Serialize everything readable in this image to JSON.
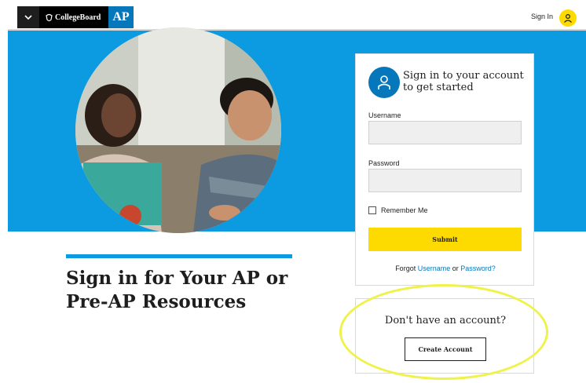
{
  "header": {
    "brand_text": "CollegeBoard",
    "ap_label": "AP",
    "signin_label": "Sign In",
    "icons": [
      "chevron-down-icon",
      "acorn-icon",
      "user-icon"
    ]
  },
  "hero": {
    "color": "#0c9ae0",
    "photo": "students-photo"
  },
  "main": {
    "title": "Sign in for Your AP or Pre-AP Resources"
  },
  "signin_card": {
    "heading": "Sign in to your account to get started",
    "username_label": "Username",
    "username_value": "",
    "password_label": "Password",
    "password_value": "",
    "remember_label": "Remember Me",
    "remember_checked": false,
    "submit_label": "Submit",
    "forgot_prefix": "Forgot",
    "forgot_username": "Username",
    "forgot_or": "or",
    "forgot_password": "Password?"
  },
  "create_card": {
    "heading": "Don't have an account?",
    "button_label": "Create Account"
  },
  "colors": {
    "brand_blue": "#0677ba",
    "hero_blue": "#0c9ae0",
    "submit_yellow": "#fedb00",
    "annotation_yellow": "#eff24a"
  }
}
